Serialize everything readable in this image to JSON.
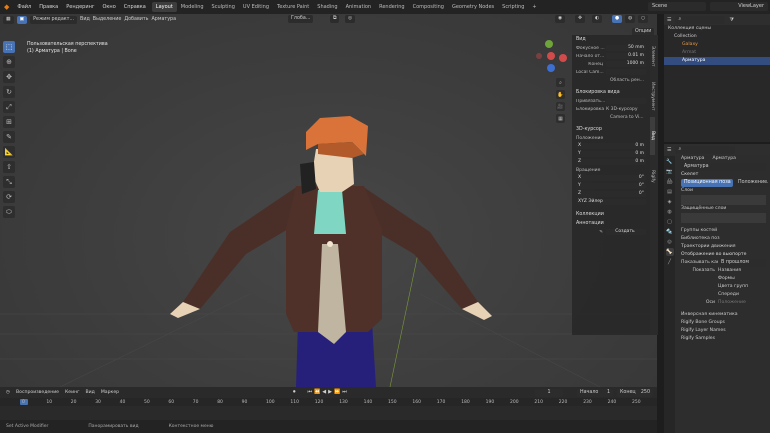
{
  "menu": {
    "items": [
      "Файл",
      "Правка",
      "Рендеринг",
      "Окно",
      "Справка"
    ],
    "workspaces": [
      "Layout",
      "Modeling",
      "Sculpting",
      "UV Editing",
      "Texture Paint",
      "Shading",
      "Animation",
      "Rendering",
      "Compositing",
      "Geometry Nodes",
      "Scripting"
    ],
    "active_workspace": "Layout",
    "scene": "Scene",
    "view_layer": "ViewLayer"
  },
  "viewport_header": {
    "mode": "Режим редакт...",
    "view": "Вид",
    "select": "Выделение",
    "add": "Добавить",
    "armature": "Арматура",
    "transform": "Глоба...",
    "options": "Опции"
  },
  "overlay": {
    "line1": "Пользовательская перспектива",
    "line2": "(1) Арматура | Bone"
  },
  "npanel": {
    "tab_labels": [
      "Элемент",
      "Инструмент",
      "Вид",
      "Rigify"
    ],
    "view_section": "Вид",
    "focal_label": "Фокусное ...",
    "focal_value": "50 mm",
    "clip_start_label": "Начало от...",
    "clip_start_value": "0.01 m",
    "clip_end_label": "Конец",
    "clip_end_value": "1000 m",
    "local_cam_label": "Local Cam...",
    "render_region": "Область рен...",
    "view_lock_section": "Блокировка вида",
    "lock_to_object": "Привязать...",
    "lock_label": "Блокировка",
    "lock_3d_cursor": "К 3D-курсору",
    "camera_to_view": "Camera to Vi...",
    "cursor_section": "3D-курсор",
    "location_label": "Положение",
    "rotation_label": "Вращение",
    "xyz": [
      "X",
      "Y",
      "Z"
    ],
    "loc_values": [
      "0 m",
      "0 m",
      "0 m"
    ],
    "rot_values": [
      "0°",
      "0°",
      "0°"
    ],
    "rot_mode": "XYZ Эйлер",
    "collections_section": "Коллекции",
    "annotations_section": "Аннотации",
    "new_label": "Создать"
  },
  "outliner": {
    "scene_collection": "Коллекция сцены",
    "collection": "Collection",
    "item1": "Galaxy",
    "item2": "Armat",
    "item3": "Арматура"
  },
  "properties": {
    "object_left": "Арматура",
    "object_right": "Арматура",
    "name_field": "Арматура",
    "skeleton_section": "Скелет",
    "pose_position": "Позиционная поза",
    "rest_position": "Положение...",
    "layers_label": "Слои",
    "protected_layers": "Защищённые слои",
    "bone_groups": "Группы костей",
    "pose_library": "Библиотека поз",
    "motion_paths": "Траектории движения",
    "viewport_display": "Отображение во вьюпорте",
    "display_as_label": "Показывать как",
    "display_as_value": "В прошлом",
    "show_label": "Показать",
    "names": "Названия",
    "shapes": "Формы",
    "group_colors": "Цвета групп",
    "axes": "Спереди",
    "in_front_label": "Оси",
    "position_label": "Положение",
    "ik": "Инверсная кинематика",
    "rigify_bone_groups": "Rigify Bone Groups",
    "rigify_layer_names": "Rigify Layer Names",
    "rigify_samples": "Rigify Samples"
  },
  "timeline": {
    "playback": "Воспроизведение",
    "keying": "Кеинг",
    "view": "Вид",
    "marker": "Маркер",
    "current_frame": "1",
    "start_label": "Начало",
    "start_value": "1",
    "end_label": "Конец",
    "end_value": "250",
    "ticks": [
      "0",
      "10",
      "20",
      "30",
      "40",
      "50",
      "60",
      "70",
      "80",
      "90",
      "100",
      "110",
      "120",
      "130",
      "140",
      "150",
      "160",
      "170",
      "180",
      "190",
      "200",
      "210",
      "220",
      "230",
      "240",
      "250"
    ]
  },
  "status": {
    "item1": "Set Active Modifier",
    "item2": "Панорамировать вид",
    "item3": "Контекстное меню"
  },
  "colors": {
    "accent": "#4772b3",
    "active_tab": "#3d3d3d",
    "hair": "#d9733a",
    "jacket": "#4a2f28",
    "shirt": "#7fd6c2",
    "tie": "#bfb5a0",
    "pants": "#27207a",
    "skin": "#e8d2b5"
  }
}
